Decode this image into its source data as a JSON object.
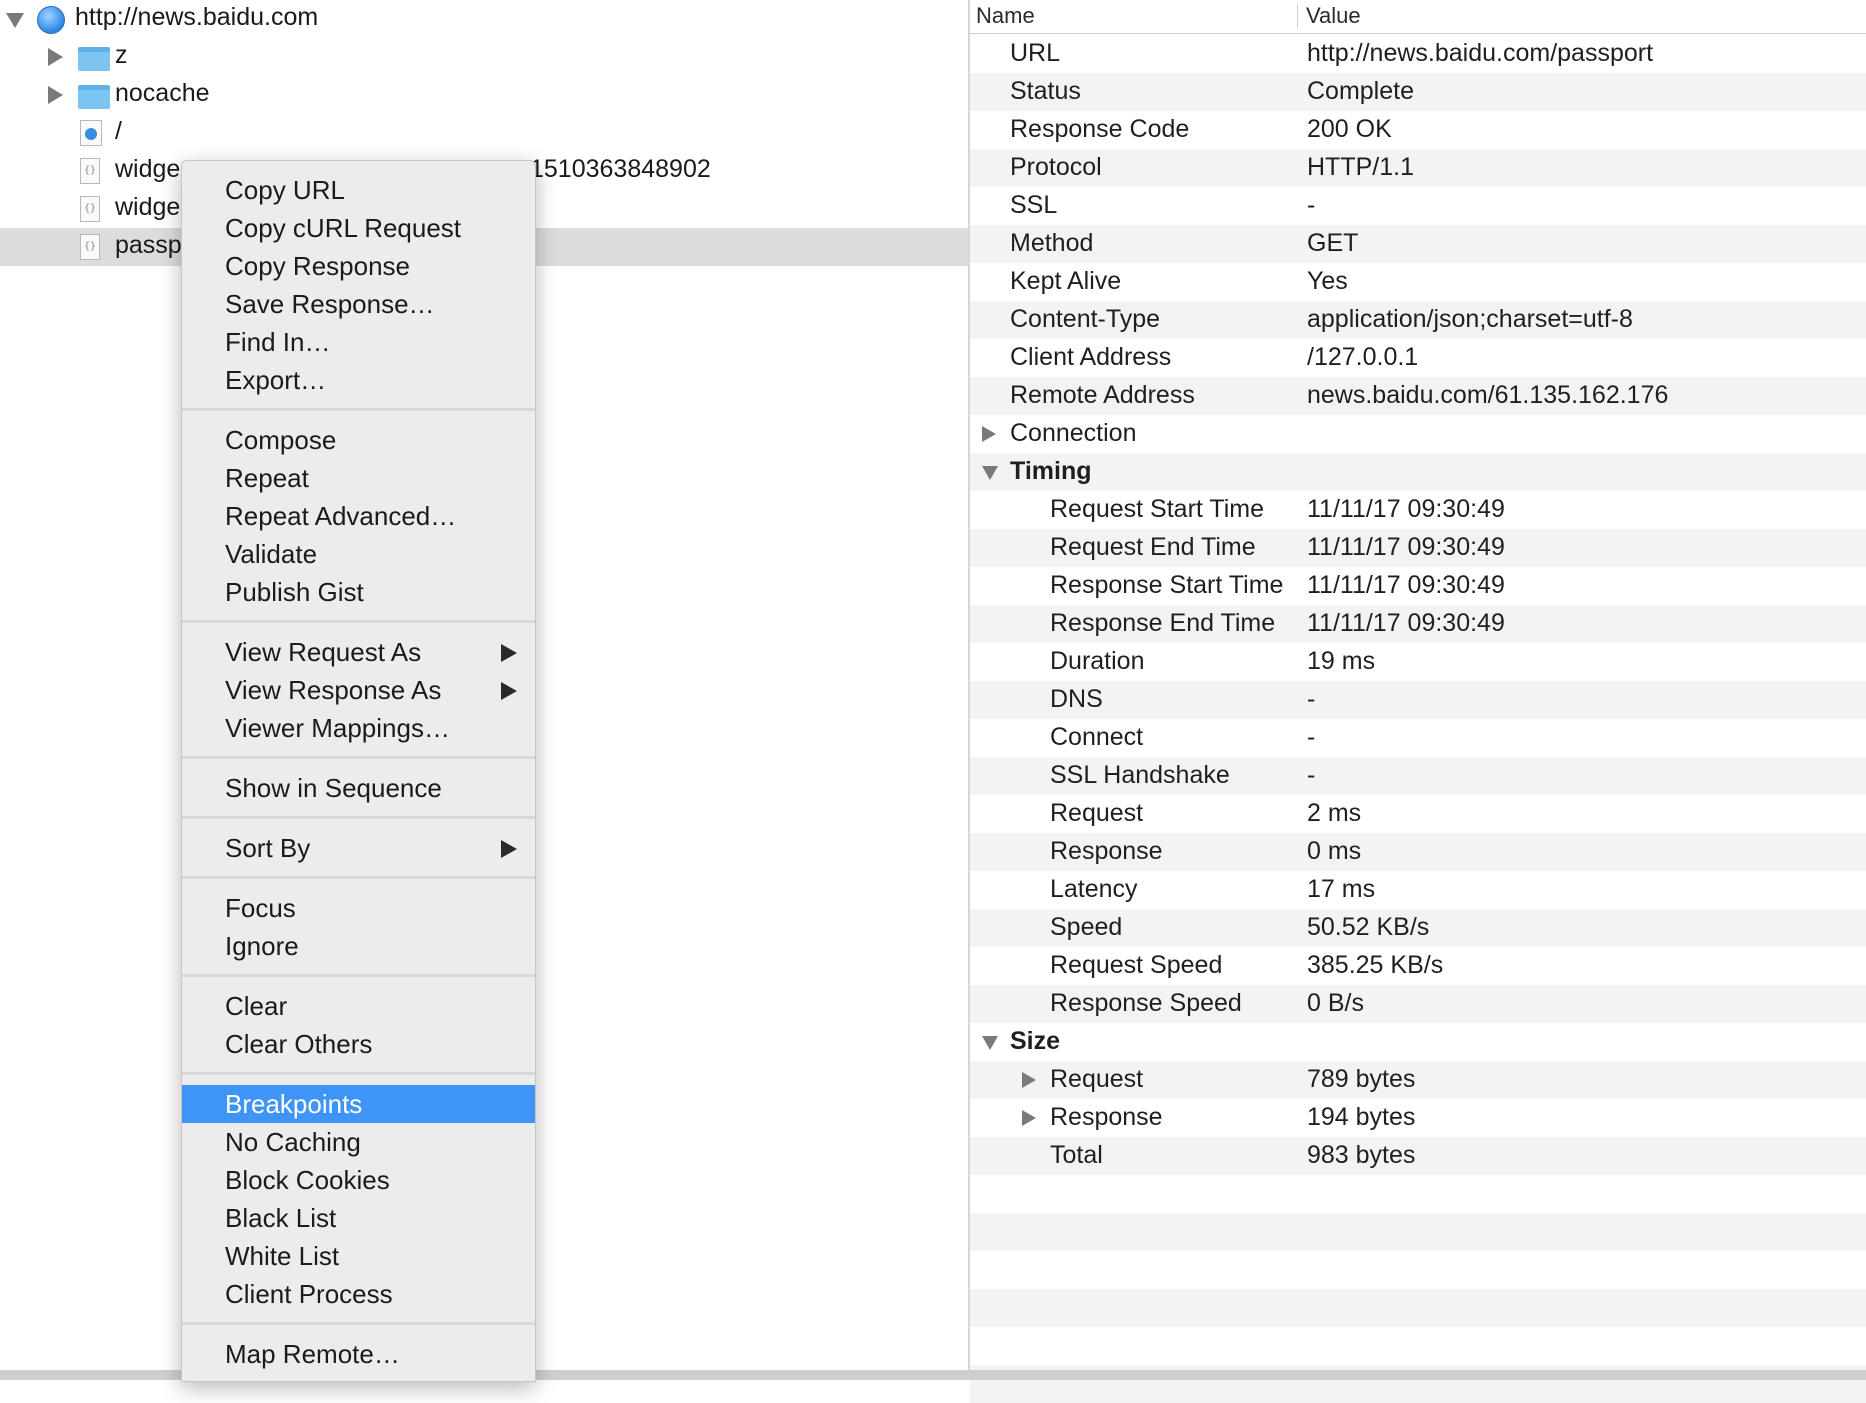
{
  "tree": {
    "root": {
      "label": "http://news.baidu.com",
      "icon": "globe-icon"
    },
    "items": [
      {
        "label": "z",
        "icon": "folder-icon"
      },
      {
        "label": "nocache",
        "icon": "folder-icon"
      },
      {
        "label": "/",
        "icon": "page-icon"
      },
      {
        "label": "widge",
        "icon": "json-file-icon",
        "suffix": "1510363848902"
      },
      {
        "label": "widge",
        "icon": "json-file-icon"
      },
      {
        "label": "passp",
        "icon": "json-file-icon"
      }
    ]
  },
  "detail": {
    "headers": {
      "name": "Name",
      "value": "Value"
    },
    "rows": [
      {
        "name": "URL",
        "value": "http://news.baidu.com/passport"
      },
      {
        "name": "Status",
        "value": "Complete"
      },
      {
        "name": "Response Code",
        "value": "200 OK"
      },
      {
        "name": "Protocol",
        "value": "HTTP/1.1"
      },
      {
        "name": "SSL",
        "value": "-"
      },
      {
        "name": "Method",
        "value": "GET"
      },
      {
        "name": "Kept Alive",
        "value": "Yes"
      },
      {
        "name": "Content-Type",
        "value": "application/json;charset=utf-8"
      },
      {
        "name": "Client Address",
        "value": "/127.0.0.1"
      },
      {
        "name": "Remote Address",
        "value": "news.baidu.com/61.135.162.176"
      },
      {
        "name": "Connection",
        "value": ""
      },
      {
        "name": "Timing",
        "value": ""
      },
      {
        "name": "Request Start Time",
        "value": "11/11/17 09:30:49"
      },
      {
        "name": "Request End Time",
        "value": "11/11/17 09:30:49"
      },
      {
        "name": "Response Start Time",
        "value": "11/11/17 09:30:49"
      },
      {
        "name": "Response End Time",
        "value": "11/11/17 09:30:49"
      },
      {
        "name": "Duration",
        "value": "19 ms"
      },
      {
        "name": "DNS",
        "value": "-"
      },
      {
        "name": "Connect",
        "value": "-"
      },
      {
        "name": "SSL Handshake",
        "value": "-"
      },
      {
        "name": "Request",
        "value": "2 ms"
      },
      {
        "name": "Response",
        "value": "0 ms"
      },
      {
        "name": "Latency",
        "value": "17 ms"
      },
      {
        "name": "Speed",
        "value": "50.52 KB/s"
      },
      {
        "name": "Request Speed",
        "value": "385.25 KB/s"
      },
      {
        "name": "Response Speed",
        "value": "0 B/s"
      },
      {
        "name": "Size",
        "value": ""
      },
      {
        "name": "Request",
        "value": "789 bytes"
      },
      {
        "name": "Response",
        "value": "194 bytes"
      },
      {
        "name": "Total",
        "value": "983 bytes"
      }
    ]
  },
  "menu": {
    "groups": [
      [
        "Copy URL",
        "Copy cURL Request",
        "Copy Response",
        "Save Response…",
        "Find In…",
        "Export…"
      ],
      [
        "Compose",
        "Repeat",
        "Repeat Advanced…",
        "Validate",
        "Publish Gist"
      ],
      [
        "View Request As",
        "View Response As",
        "Viewer Mappings…"
      ],
      [
        "Show in Sequence"
      ],
      [
        "Sort By"
      ],
      [
        "Focus",
        "Ignore"
      ],
      [
        "Clear",
        "Clear Others"
      ],
      [
        "Breakpoints",
        "No Caching",
        "Block Cookies",
        "Black List",
        "White List",
        "Client Process"
      ],
      [
        "Map Remote…"
      ]
    ],
    "submenu_items": [
      "View Request As",
      "View Response As",
      "Sort By"
    ],
    "highlighted": "Breakpoints"
  },
  "colors": {
    "menu_highlight": "#3f94f7",
    "selected_row": "#dcdcdc",
    "alt_row": "#f3f3f3"
  }
}
